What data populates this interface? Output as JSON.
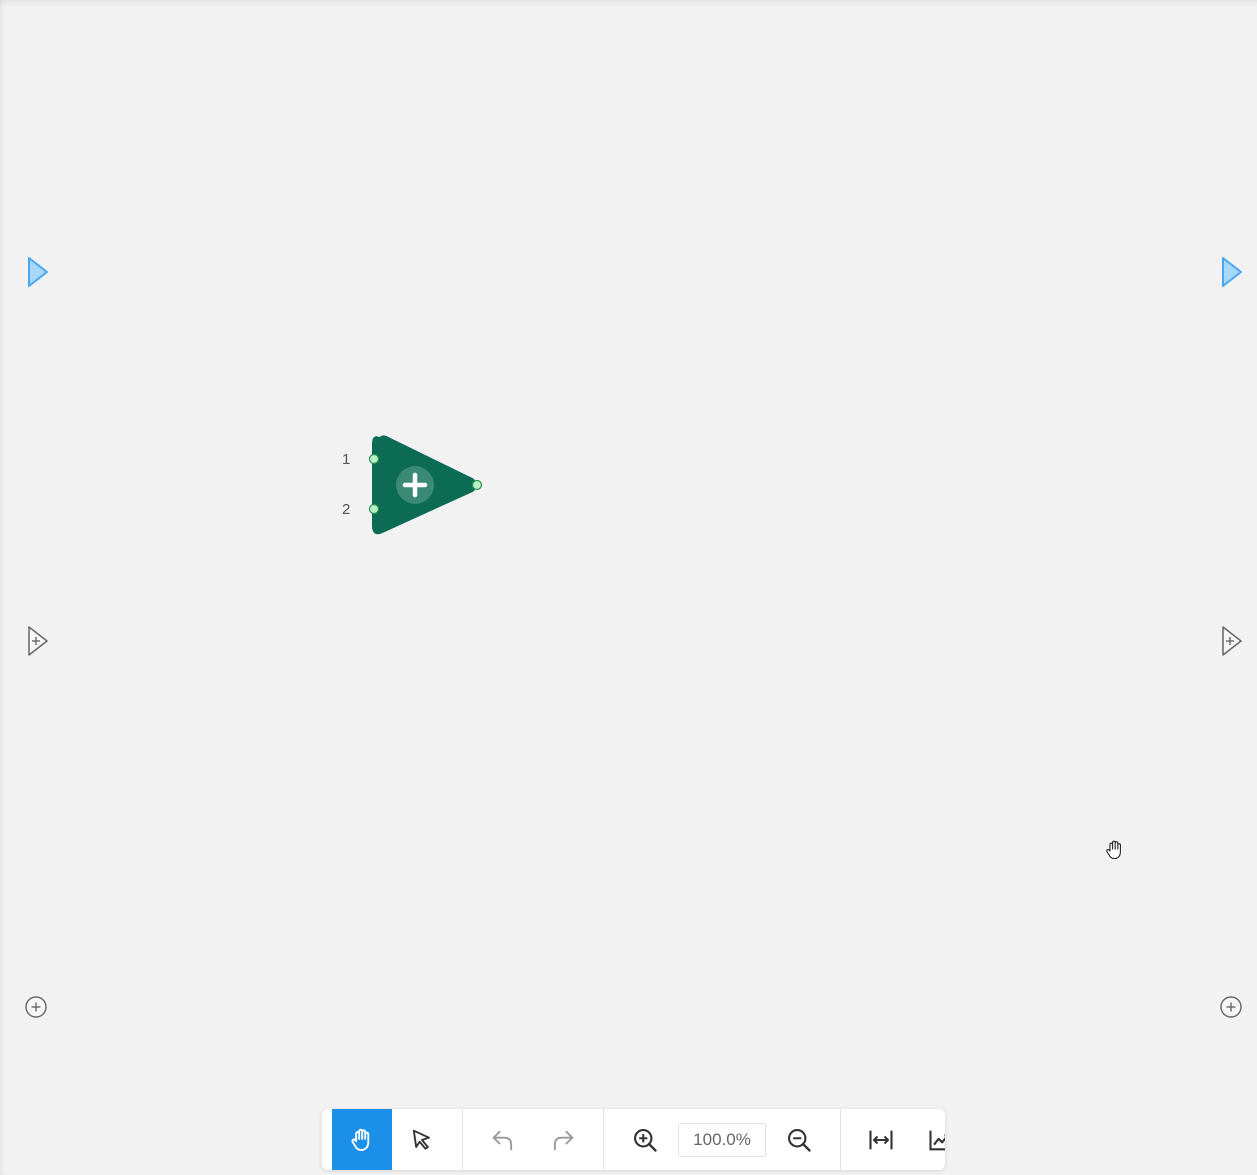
{
  "canvas": {
    "background": "#f2f2f2"
  },
  "block": {
    "type": "sum-block",
    "color": "#0b6b53",
    "icon": "plus-icon",
    "ports": {
      "input_labels": [
        "1",
        "2"
      ]
    }
  },
  "edge_controls": {
    "inport_icon": "inport-triangle-icon",
    "add_port_icon": "add-port-icon",
    "add_icon": "add-circle-icon",
    "accent": "#4aa7ef"
  },
  "toolbar": {
    "pan_icon": "hand-icon",
    "select_icon": "pointer-arrow-icon",
    "undo_icon": "undo-icon",
    "redo_icon": "redo-icon",
    "zoom_in_icon": "zoom-in-icon",
    "zoom_level": "100.0%",
    "zoom_out_icon": "zoom-out-icon",
    "fit_icon": "fit-width-icon",
    "plot_icon": "chart-icon",
    "active_color": "#1c8fe8"
  }
}
